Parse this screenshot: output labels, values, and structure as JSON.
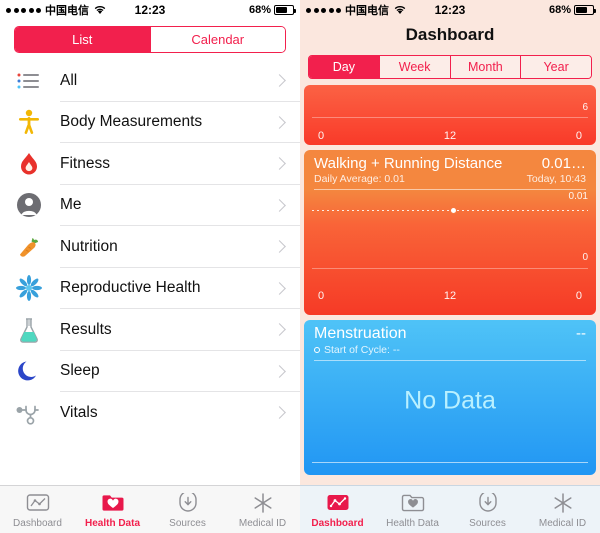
{
  "status_bar": {
    "signal_dots": 5,
    "carrier": "中国电信",
    "wifi_icon": "wifi-icon",
    "time": "12:23",
    "battery_percent": "68%",
    "battery_level": 68
  },
  "left_screen": {
    "segmented_control": {
      "options": [
        "List",
        "Calendar"
      ],
      "selected": "List"
    },
    "list_items": [
      {
        "label": "All",
        "icon": "list-lines-icon"
      },
      {
        "label": "Body Measurements",
        "icon": "body-figure-icon"
      },
      {
        "label": "Fitness",
        "icon": "flame-icon"
      },
      {
        "label": "Me",
        "icon": "person-silhouette-icon"
      },
      {
        "label": "Nutrition",
        "icon": "carrot-icon"
      },
      {
        "label": "Reproductive Health",
        "icon": "flower-icon"
      },
      {
        "label": "Results",
        "icon": "flask-icon"
      },
      {
        "label": "Sleep",
        "icon": "crescent-moon-icon"
      },
      {
        "label": "Vitals",
        "icon": "stethoscope-icon"
      }
    ],
    "tab_bar": {
      "items": [
        {
          "label": "Dashboard",
          "icon": "chart-icon",
          "active": false
        },
        {
          "label": "Health Data",
          "icon": "folder-heart-icon",
          "active": true
        },
        {
          "label": "Sources",
          "icon": "download-heart-icon",
          "active": false
        },
        {
          "label": "Medical ID",
          "icon": "asterisk-icon",
          "active": false
        }
      ]
    }
  },
  "right_screen": {
    "nav_title": "Dashboard",
    "segmented_control": {
      "options": [
        "Day",
        "Week",
        "Month",
        "Year"
      ],
      "selected": "Day"
    },
    "cards": [
      {
        "id": "card-partial-top",
        "max_label": "6",
        "x_axis": [
          "0",
          "12",
          "0"
        ]
      },
      {
        "id": "card-walking-running",
        "title": "Walking + Running Distance",
        "value": "0.01…",
        "subtitle": "Daily Average: 0.01",
        "timestamp": "Today, 10:43",
        "max_label": "0.01",
        "min_label": "0",
        "x_axis": [
          "0",
          "12",
          "0"
        ]
      },
      {
        "id": "card-menstruation",
        "title": "Menstruation",
        "value": "--",
        "subtitle": "Start of Cycle: --",
        "empty_state": "No Data"
      }
    ],
    "tab_bar": {
      "items": [
        {
          "label": "Dashboard",
          "icon": "chart-icon",
          "active": true
        },
        {
          "label": "Health Data",
          "icon": "folder-heart-icon",
          "active": false
        },
        {
          "label": "Sources",
          "icon": "download-heart-icon",
          "active": false
        },
        {
          "label": "Medical ID",
          "icon": "asterisk-icon",
          "active": false
        }
      ]
    }
  },
  "chart_data": [
    {
      "type": "line",
      "title": "",
      "x": [
        0,
        12,
        24
      ],
      "xlabel": "",
      "ylabel": "",
      "values": [
        null,
        null,
        null
      ],
      "tick_labels_x": [
        "0",
        "12",
        "0"
      ],
      "ylim": [
        0,
        6
      ],
      "tick_labels_y": [
        "6"
      ],
      "grid": true,
      "legend": "none"
    },
    {
      "type": "line",
      "title": "Walking + Running Distance",
      "x": [
        0,
        12,
        24
      ],
      "xlabel": "",
      "ylabel": "",
      "values": [
        0.01,
        0.01,
        0.01
      ],
      "tick_labels_x": [
        "0",
        "12",
        "0"
      ],
      "ylim": [
        0,
        0.01
      ],
      "tick_labels_y": [
        "0.01",
        "0"
      ],
      "data_points": [
        {
          "x": 12,
          "y": 0.01
        }
      ],
      "grid": true,
      "legend": "none",
      "annotations": [
        "Daily Average: 0.01",
        "Today, 10:43"
      ]
    },
    {
      "type": "line",
      "title": "Menstruation",
      "x": [],
      "values": [],
      "xlabel": "",
      "ylabel": "",
      "grid": false,
      "legend": "none",
      "annotations": [
        "Start of Cycle: --",
        "No Data"
      ]
    }
  ]
}
